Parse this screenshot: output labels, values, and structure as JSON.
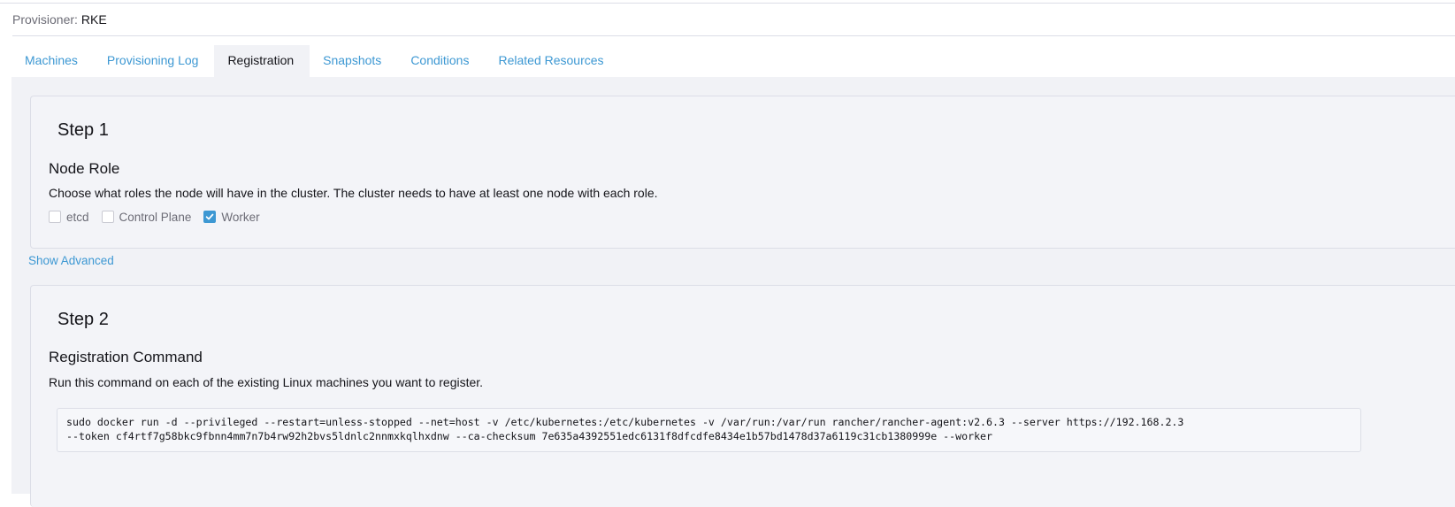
{
  "header": {
    "provisioner_label": "Provisioner:",
    "provisioner_value": "RKE"
  },
  "tabs": [
    {
      "label": "Machines",
      "active": false
    },
    {
      "label": "Provisioning Log",
      "active": false
    },
    {
      "label": "Registration",
      "active": true
    },
    {
      "label": "Snapshots",
      "active": false
    },
    {
      "label": "Conditions",
      "active": false
    },
    {
      "label": "Related Resources",
      "active": false
    }
  ],
  "step1": {
    "title": "Step 1",
    "section_title": "Node Role",
    "description": "Choose what roles the node will have in the cluster. The cluster needs to have at least one node with each role.",
    "roles": [
      {
        "label": "etcd",
        "checked": false
      },
      {
        "label": "Control Plane",
        "checked": false
      },
      {
        "label": "Worker",
        "checked": true
      }
    ]
  },
  "show_advanced_label": "Show Advanced",
  "step2": {
    "title": "Step 2",
    "section_title": "Registration Command",
    "description": "Run this command on each of the existing Linux machines you want to register.",
    "command_lines": [
      "sudo docker run -d --privileged --restart=unless-stopped --net=host -v /etc/kubernetes:/etc/kubernetes -v /var/run:/var/run rancher/rancher-agent:v2.6.3 --server https://192.168.2.3",
      "--token cf4rtf7g58bkc9fbnn4mm7n7b4rw92h2bvs5ldnlc2nnmxkqlhxdnw --ca-checksum 7e635a4392551edc6131f8dfcdfe8434e1b57bd1478d37a6119c31cb1380999e --worker"
    ]
  },
  "colors": {
    "accent": "#3d98d3",
    "text": "#141419",
    "muted": "#6c6c76",
    "panel_bg": "#f1f2f6",
    "border": "#dcdee7"
  },
  "icons": {
    "checkbox_checked": "check-icon"
  }
}
